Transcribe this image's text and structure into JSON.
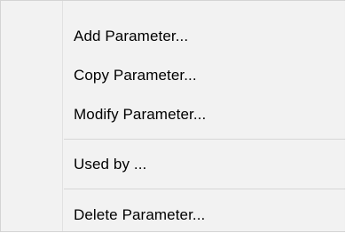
{
  "context_menu": {
    "items": [
      {
        "label": "Add Parameter..."
      },
      {
        "label": "Copy Parameter..."
      },
      {
        "label": "Modify Parameter..."
      },
      {
        "label": "Used by ..."
      },
      {
        "label": "Delete Parameter..."
      }
    ]
  }
}
